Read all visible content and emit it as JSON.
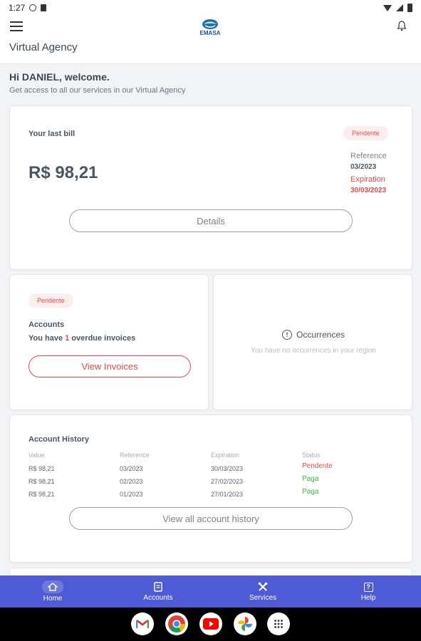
{
  "status_bar": {
    "time": "1:27"
  },
  "app_bar": {
    "logo_text": "EMASA",
    "title": "Virtual Agency"
  },
  "welcome": {
    "greeting": "Hi DANIEL, welcome.",
    "subtitle": "Get access to all our services in our Virtual Agency"
  },
  "last_bill": {
    "title": "Your last bill",
    "amount": "R$ 98,21",
    "status": "Pendente",
    "reference_label": "Reference",
    "reference_value": "03/2023",
    "expiration_label": "Expiration",
    "expiration_value": "30/03/2023",
    "details_label": "Details"
  },
  "accounts": {
    "status": "Pendente",
    "title": "Accounts",
    "overdue_prefix": "You have ",
    "overdue_count": "1",
    "overdue_suffix": " overdue invoices",
    "button_label": "View Invoices"
  },
  "occurrences": {
    "title": "Occurrences",
    "message": "You have no occurrences in your region"
  },
  "history": {
    "title": "Account History",
    "headers": [
      "Value",
      "Reference",
      "Expiration",
      "Status"
    ],
    "rows": [
      {
        "value": "R$ 98,21",
        "reference": "03/2023",
        "expiration": "30/03/2023",
        "status": "Pendente"
      },
      {
        "value": "R$ 98,21",
        "reference": "02/2023",
        "expiration": "27/02/2023",
        "status": "Paga"
      },
      {
        "value": "R$ 98,21",
        "reference": "01/2023",
        "expiration": "27/01/2023",
        "status": "Paga"
      }
    ],
    "button_label": "View all account history"
  },
  "bottom_nav": {
    "items": [
      {
        "label": "Home"
      },
      {
        "label": "Accounts"
      },
      {
        "label": "Services"
      },
      {
        "label": "Help"
      }
    ]
  },
  "colors": {
    "primary": "#4f5bd5",
    "danger": "#e24a4a",
    "success": "#3cb44b",
    "text": "#3d4756"
  }
}
